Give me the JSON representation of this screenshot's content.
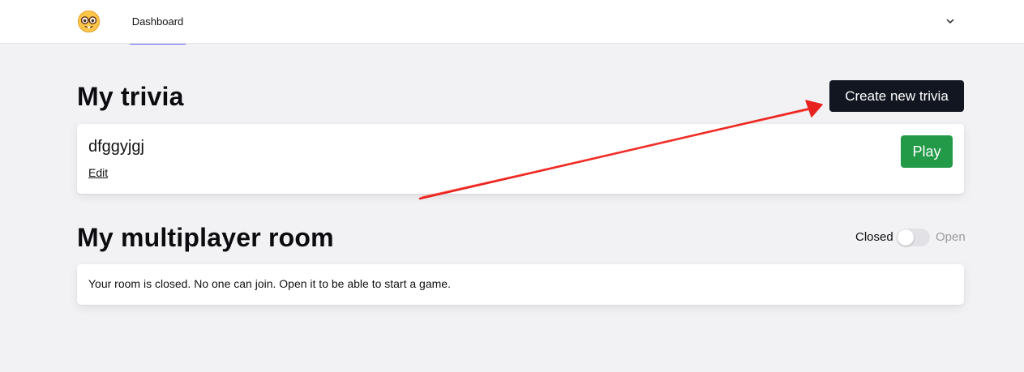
{
  "nav": {
    "logo_icon": "nerd-face-emoji-icon",
    "link_label": "Dashboard",
    "menu_icon": "chevron-down-icon",
    "active_underline_color": "#6d6af0"
  },
  "trivia_section": {
    "title": "My trivia",
    "create_button_label": "Create new trivia",
    "items": [
      {
        "name": "dfggyjgj",
        "edit_label": "Edit",
        "play_label": "Play"
      }
    ]
  },
  "room_section": {
    "title": "My multiplayer room",
    "toggle": {
      "off_label": "Closed",
      "on_label": "Open",
      "is_open": false
    },
    "status_message": "Your room is closed. No one can join. Open it to be able to start a game."
  },
  "colors": {
    "background": "#f2f2f4",
    "primary_button": "#121621",
    "play_button": "#239a48",
    "annotation_arrow": "#e8231f"
  },
  "annotation": {
    "type": "arrow",
    "icon": "red-arrow-icon",
    "points_to": "create-trivia-button"
  }
}
